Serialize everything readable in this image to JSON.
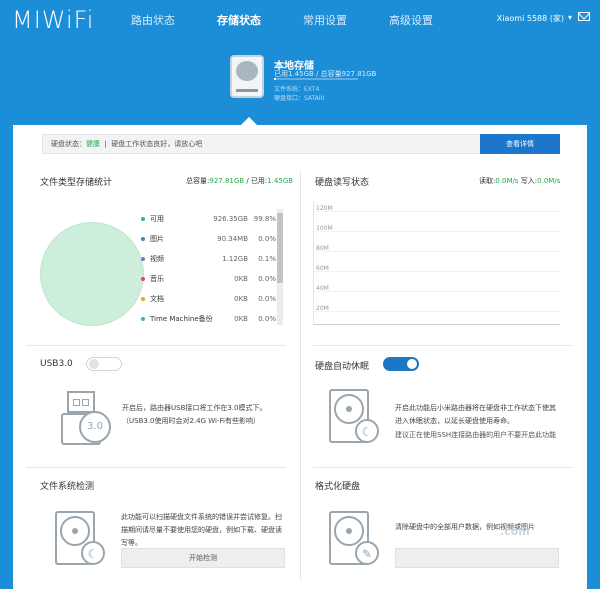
{
  "header": {
    "logo": "MIWiFi",
    "nav": [
      "路由状态",
      "存储状态",
      "常用设置",
      "高级设置"
    ],
    "router": "Xiaomi 5588 (家)"
  },
  "drive": {
    "name": "本地存储",
    "usage": "已用1.45GB / 总容量927.81GB",
    "fs": "文件系统：EXT4",
    "iface": "硬盘接口：SATAIII",
    "used_fraction": 0.0016
  },
  "status": {
    "prefix": "硬盘状态：",
    "value": "健康",
    "message": "硬盘工作状态良好，请放心吧",
    "button": "查看详情"
  },
  "storage_stats": {
    "title": "文件类型存储统计",
    "total_label": "总容量:",
    "total": "927.81GB",
    "used_label": "/ 已用:",
    "used": "1.45GB",
    "items": [
      {
        "name": "可用",
        "size": "926.35GB",
        "pct": "99.8%",
        "color": "#2fbf5a"
      },
      {
        "name": "图片",
        "size": "90.34MB",
        "pct": "0.0%",
        "color": "#2a8fd8"
      },
      {
        "name": "视频",
        "size": "1.12GB",
        "pct": "0.1%",
        "color": "#8a6fc7"
      },
      {
        "name": "音乐",
        "size": "0KB",
        "pct": "0.0%",
        "color": "#e24c4c"
      },
      {
        "name": "文档",
        "size": "0KB",
        "pct": "0.0%",
        "color": "#f0a22a"
      },
      {
        "name": "Time Machine备份",
        "size": "0KB",
        "pct": "0.0%",
        "color": "#3bb4c7"
      }
    ]
  },
  "io": {
    "title": "硬盘读写状态",
    "read_label": "读取:",
    "read": "0.0M/s",
    "write_label": "写入:",
    "write": "0.0M/s",
    "ticks": [
      "120M",
      "100M",
      "80M",
      "60M",
      "40M",
      "20M"
    ]
  },
  "usb": {
    "title": "USB3.0",
    "enabled": false,
    "desc1": "开启后，路由器USB接口将工作在3.0模式下。",
    "desc2": "（USB3.0使用时会对2.4G Wi-Fi有些影响）",
    "icon_text": "3.0"
  },
  "sleep": {
    "title": "硬盘自动休眠",
    "enabled": true,
    "desc1": "开启此功能后小米路由器将在硬盘非工作状态下使其",
    "desc2": "进入休眠状态，以延长硬盘使用寿命。",
    "note": "建议正在使用SSH连接路由器的用户不要开启此功能"
  },
  "fscheck": {
    "title": "文件系统检测",
    "desc1": "此功能可以扫描硬盘文件系统的错误并尝试修复。扫",
    "desc2": "描期间请尽量不要使用您的硬盘，例如下载、硬盘读",
    "desc3": "写等。",
    "button": "开始检测"
  },
  "format": {
    "title": "格式化硬盘",
    "desc1": "清除硬盘中的全部用户数据，例如视频或图片"
  },
  "watermark": ".com"
}
